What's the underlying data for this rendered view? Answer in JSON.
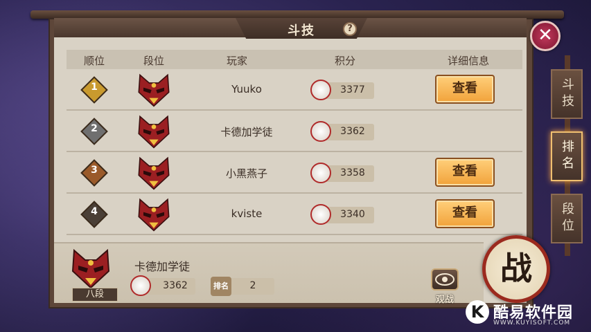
{
  "title": "斗技",
  "header": {
    "rank": "顺位",
    "tier": "段位",
    "player": "玩家",
    "points": "积分",
    "details": "详细信息"
  },
  "rows": [
    {
      "rank": "1",
      "name": "Yuuko",
      "score": "3377",
      "view": "查看",
      "badge_color": "#c99a2e"
    },
    {
      "rank": "2",
      "name": "卡德加学徒",
      "score": "3362",
      "view": "",
      "badge_color": "#6f6f6f"
    },
    {
      "rank": "3",
      "name": "小黑燕子",
      "score": "3358",
      "view": "查看",
      "badge_color": "#9a5a2a"
    },
    {
      "rank": "4",
      "name": "kviste",
      "score": "3340",
      "view": "查看",
      "badge_color": "#4a3f36"
    }
  ],
  "self": {
    "name": "卡德加学徒",
    "tier": "八段",
    "score": "3362",
    "rank_label": "排名",
    "rank": "2"
  },
  "watch_label": "观战",
  "battle_label": "战",
  "tabs": [
    {
      "label": "斗技"
    },
    {
      "label": "排名"
    },
    {
      "label": "段位"
    }
  ],
  "watermark": {
    "logo": "K",
    "text": "酷易软件园",
    "sub": "WWW.KUYISOFT.COM"
  },
  "colors": {
    "accent": "#f1a23a",
    "close": "#c33a5d",
    "drum_rim": "#9b2a1e"
  }
}
